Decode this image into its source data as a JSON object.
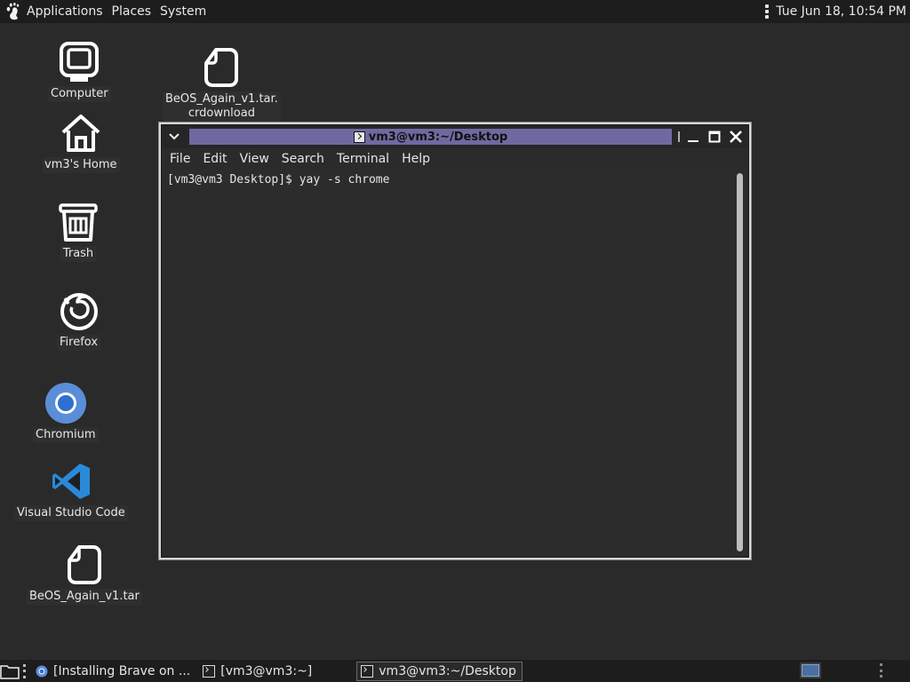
{
  "top_panel": {
    "applications": "Applications",
    "places": "Places",
    "system": "System",
    "clock": "Tue Jun 18, 10:54 PM"
  },
  "desktop": {
    "icons": [
      {
        "label": "Computer",
        "icon": "computer-icon"
      },
      {
        "label": "vm3's Home",
        "icon": "home-icon"
      },
      {
        "label": "Trash",
        "icon": "trash-icon"
      },
      {
        "label": "Firefox",
        "icon": "firefox-icon"
      },
      {
        "label": "Chromium",
        "icon": "chromium-icon"
      },
      {
        "label": "Visual Studio Code",
        "icon": "vscode-icon"
      },
      {
        "label": "BeOS_Again_v1.tar",
        "icon": "file-icon"
      },
      {
        "label_line1": "BeOS_Again_v1.tar.",
        "label_line2": "crdownload",
        "icon": "file-icon"
      }
    ]
  },
  "terminal": {
    "title": "vm3@vm3:~/Desktop",
    "menu": [
      "File",
      "Edit",
      "View",
      "Search",
      "Terminal",
      "Help"
    ],
    "content": "[vm3@vm3 Desktop]$ yay -s chrome"
  },
  "taskbar": {
    "tasks": [
      {
        "label": "[Installing Brave on ..."
      },
      {
        "label": "[vm3@vm3:~]"
      },
      {
        "label": "vm3@vm3:~/Desktop"
      }
    ]
  },
  "colors": {
    "desktop_bg": "#2a2a2a",
    "panel_bg": "#1d1d1d",
    "title_active": "#6e6aa0",
    "workspace": "#4a6fa3"
  }
}
